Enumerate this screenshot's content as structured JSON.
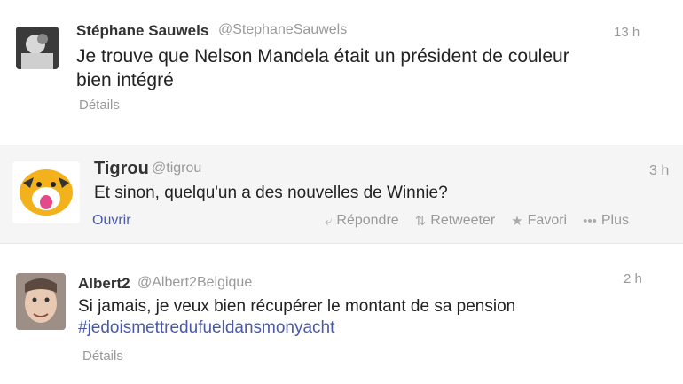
{
  "tweets": [
    {
      "name": "Stéphane Sauwels",
      "handle": "@StephaneSauwels",
      "time": "13 h",
      "text_lines": [
        "Je trouve que Nelson Mandela était un président de couleur",
        "bien intégré"
      ],
      "footer": "Détails"
    },
    {
      "name": "Tigrou",
      "handle": "@tigrou",
      "time": "3 h",
      "text": "Et sinon, quelqu'un a des nouvelles de Winnie?",
      "footer": "Ouvrir",
      "actions": {
        "reply": "Répondre",
        "retweet": "Retweeter",
        "favorite": "Favori",
        "more": "Plus"
      }
    },
    {
      "name": "Albert2",
      "handle": "@Albert2Belgique",
      "time": "2 h",
      "text": "Si jamais, je veux bien récupérer le montant de sa pension",
      "hashtag": "#jedoismettredufueldansmonyacht",
      "footer": "Détails"
    }
  ],
  "colors": {
    "link": "#4a5aa8",
    "muted": "#999999",
    "highlight_bg": "#f5f5f5"
  },
  "icons": {
    "reply": "reply-arrow-icon",
    "retweet": "retweet-icon",
    "favorite": "star-icon",
    "more": "more-dots-icon"
  }
}
